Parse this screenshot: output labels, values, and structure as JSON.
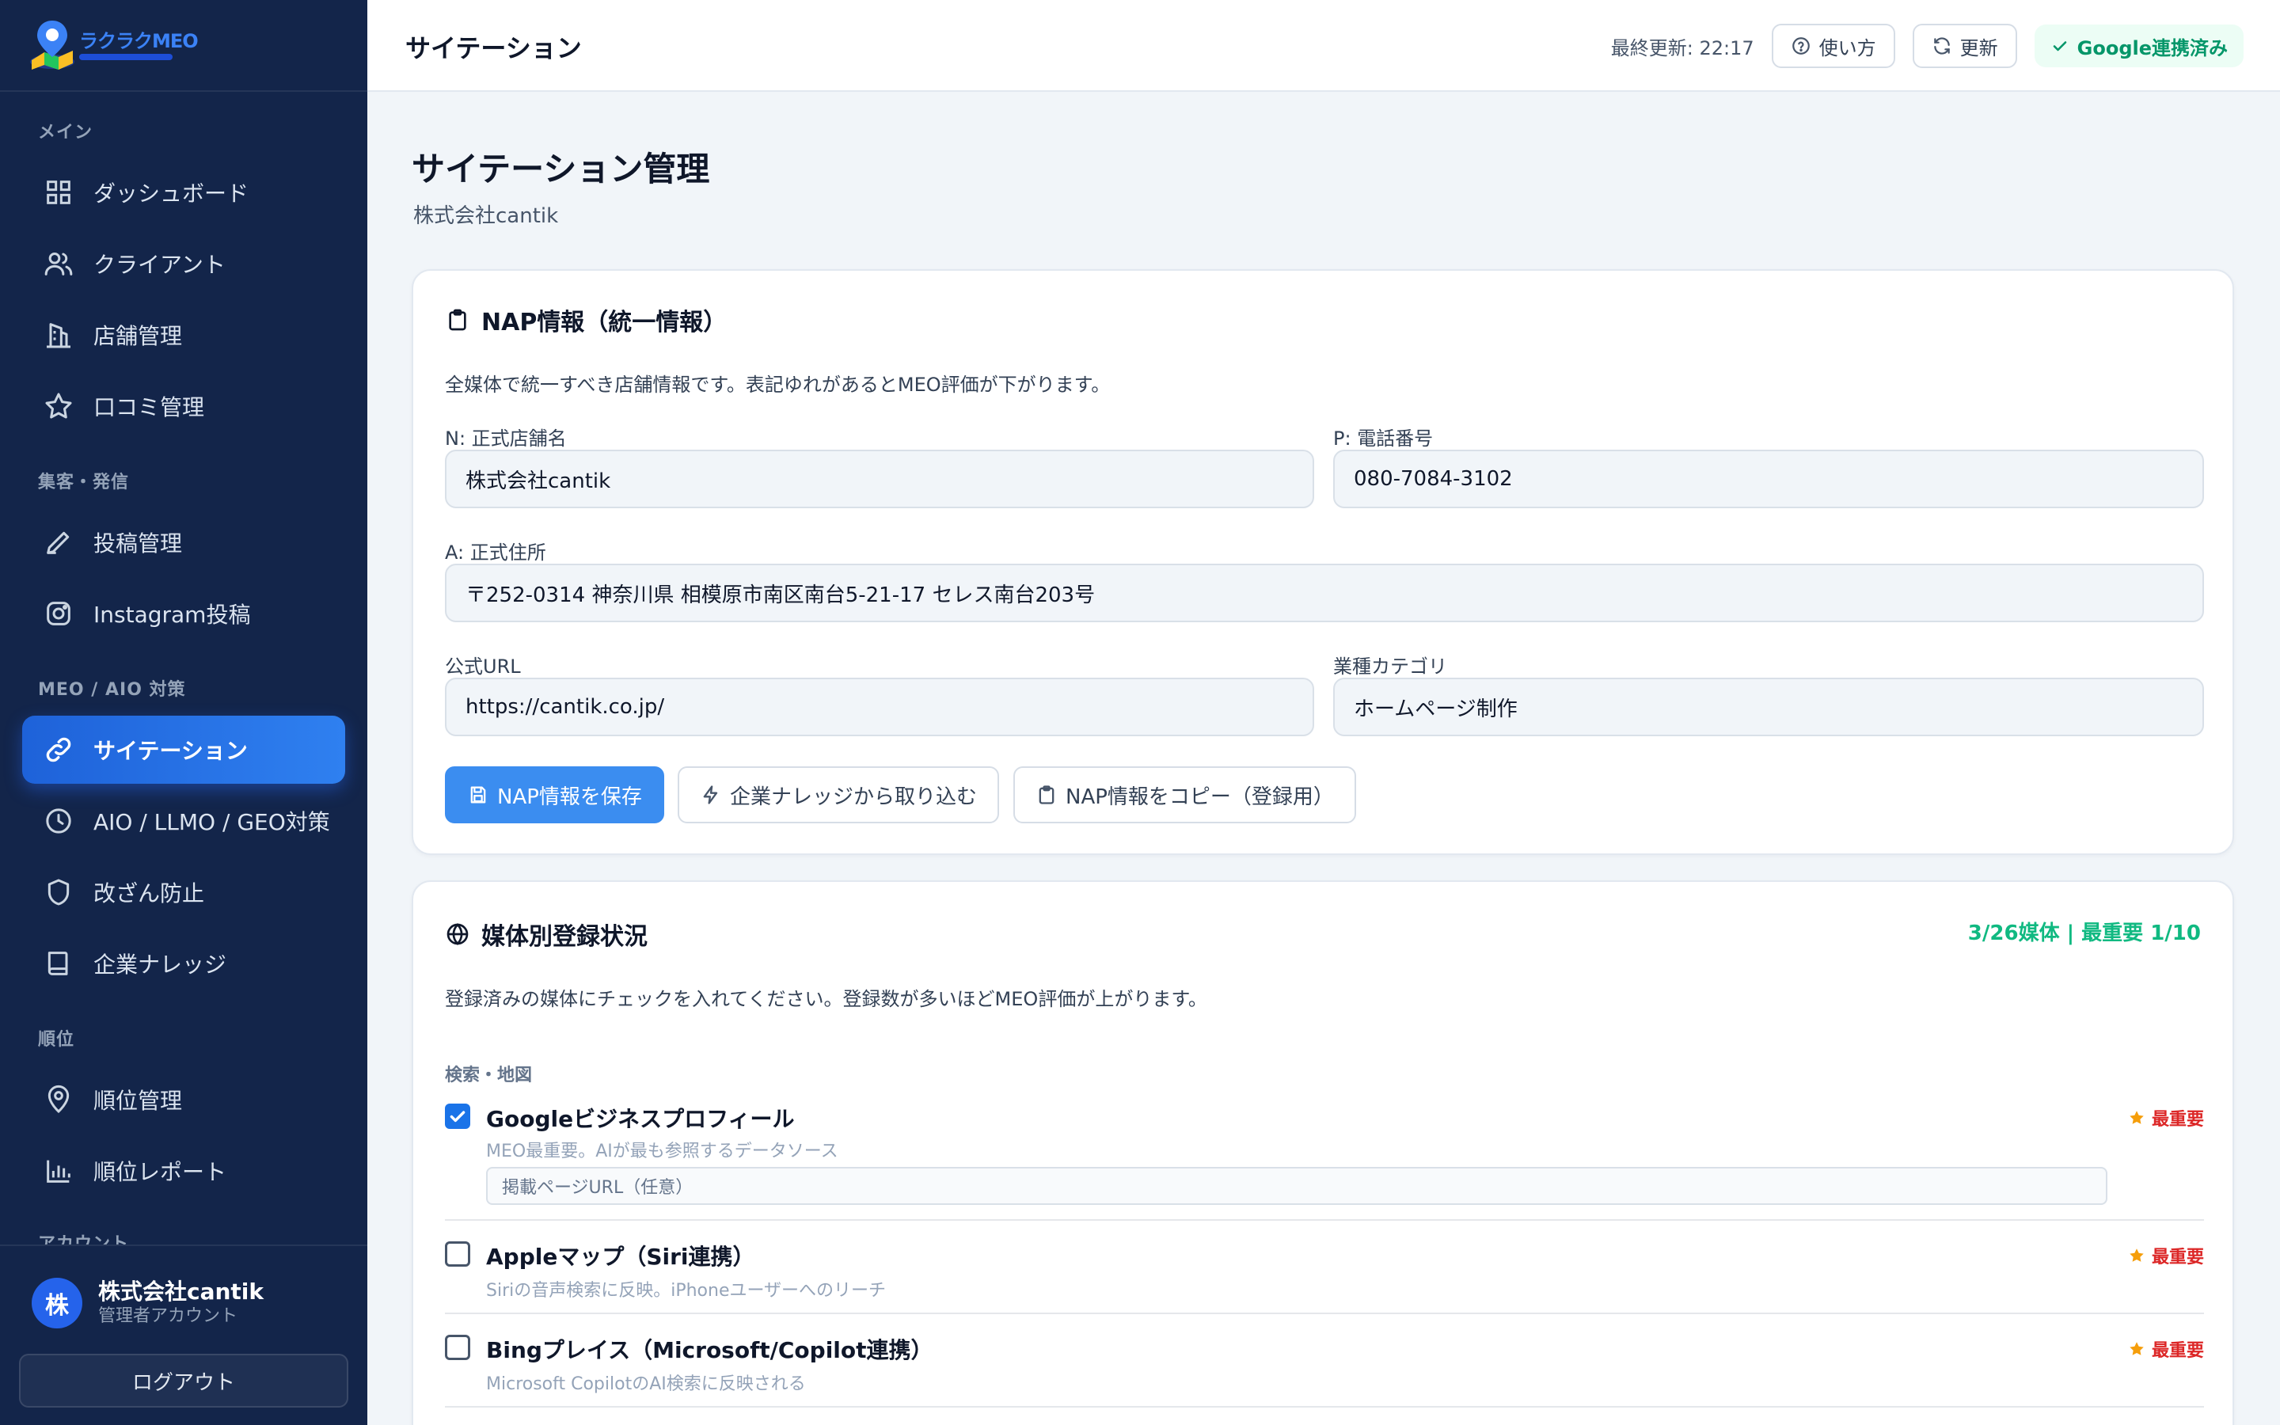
{
  "app": {
    "logo_text": "ラクラクMEO"
  },
  "sidebar": {
    "sections": [
      {
        "label": "メイン"
      },
      {
        "label": "集客・発信"
      },
      {
        "label": "MEO / AIO 対策"
      },
      {
        "label": "順位"
      },
      {
        "label": "アカウント"
      }
    ],
    "items": [
      {
        "label": "ダッシュボード",
        "icon": "grid-icon"
      },
      {
        "label": "クライアント",
        "icon": "users-icon"
      },
      {
        "label": "店舗管理",
        "icon": "store-icon"
      },
      {
        "label": "口コミ管理",
        "icon": "star-icon"
      },
      {
        "label": "投稿管理",
        "icon": "pencil-icon"
      },
      {
        "label": "Instagram投稿",
        "icon": "instagram-icon"
      },
      {
        "label": "サイテーション",
        "icon": "link-icon",
        "active": true
      },
      {
        "label": "AIO / LLMO / GEO対策",
        "icon": "clock-icon"
      },
      {
        "label": "改ざん防止",
        "icon": "shield-icon"
      },
      {
        "label": "企業ナレッジ",
        "icon": "book-icon"
      },
      {
        "label": "順位管理",
        "icon": "map-pin-icon"
      },
      {
        "label": "順位レポート",
        "icon": "bar-chart-icon"
      }
    ],
    "user": {
      "avatar": "株",
      "name": "株式会社cantik",
      "role": "管理者アカウント"
    },
    "logout_label": "ログアウト"
  },
  "topbar": {
    "title": "サイテーション",
    "updated": "最終更新: 22:17",
    "help_label": "使い方",
    "refresh_label": "更新",
    "google_badge": "Google連携済み"
  },
  "page": {
    "title": "サイテーション管理",
    "subtitle": "株式会社cantik"
  },
  "nap": {
    "title": "NAP情報（統一情報）",
    "description": "全媒体で統一すべき店舗情報です。表記ゆれがあるとMEO評価が下がります。",
    "fields": {
      "name": {
        "label": "N: 正式店舗名",
        "value": "株式会社cantik"
      },
      "phone": {
        "label": "P: 電話番号",
        "value": "080-7084-3102"
      },
      "address": {
        "label": "A: 正式住所",
        "value": "〒252-0314 神奈川県 相模原市南区南台5-21-17 セレス南台203号"
      },
      "url": {
        "label": "公式URL",
        "value": "https://cantik.co.jp/"
      },
      "category": {
        "label": "業種カテゴリ",
        "value": "ホームページ制作"
      }
    },
    "buttons": {
      "save": "NAP情報を保存",
      "import": "企業ナレッジから取り込む",
      "copy": "NAP情報をコピー（登録用）"
    }
  },
  "media": {
    "title": "媒体別登録状況",
    "count": "3/26媒体 | 最重要 1/10",
    "description": "登録済みの媒体にチェックを入れてください。登録数が多いほどMEO評価が上がります。",
    "group": "検索・地図",
    "items": [
      {
        "name": "Googleビジネスプロフィール",
        "desc": "MEO最重要。AIが最も参照するデータソース",
        "priority": "最重要",
        "checked": true,
        "url_placeholder": "掲載ページURL（任意）"
      },
      {
        "name": "Appleマップ（Siri連携）",
        "desc": "Siriの音声検索に反映。iPhoneユーザーへのリーチ",
        "priority": "最重要",
        "checked": false
      },
      {
        "name": "Bingプレイス（Microsoft/Copilot連携）",
        "desc": "Microsoft CopilotのAI検索に反映される",
        "priority": "最重要",
        "checked": false
      }
    ]
  },
  "colors": {
    "sidebar_bg": "#13254a",
    "accent": "#2563eb",
    "success": "#10b981",
    "priority": "#dc2626"
  }
}
